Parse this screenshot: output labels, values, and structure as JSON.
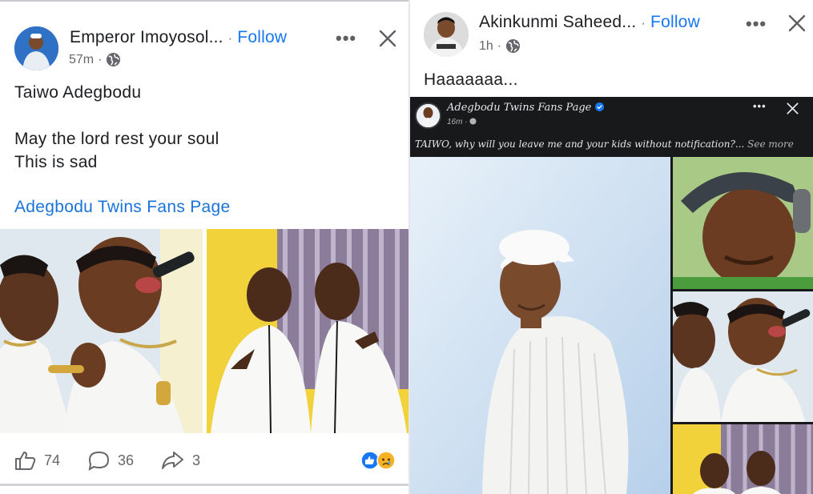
{
  "left_post": {
    "author": "Emperor Imoyosol...",
    "separator": "·",
    "follow": "Follow",
    "time": "57m",
    "more_label": "•••",
    "text_line1": "Taiwo Adegbodu",
    "text_line2": "May the lord rest your soul",
    "text_line3": "This is sad",
    "link": "Adegbodu Twins Fans Page",
    "likes": "74",
    "comments": "36",
    "shares": "3"
  },
  "right_post": {
    "author": "Akinkunmi Saheed...",
    "separator": "·",
    "follow": "Follow",
    "time": "1h",
    "more_label": "•••",
    "text": "Haaaaaaa...",
    "shared": {
      "page_name": "Adegbodu Twins Fans Page",
      "time": "16m",
      "more_label": "•••",
      "caption": "TAIWO, why will you leave me and your kids without notification?...",
      "see_more": "See more"
    }
  },
  "colors": {
    "follow_blue": "#1877f2",
    "link_blue": "#1a73d8",
    "meta_gray": "#65676b",
    "like_badge": "#1877f2",
    "sad_badge": "#f7b125"
  },
  "icons": [
    "globe-icon",
    "close-icon",
    "like-icon",
    "comment-icon",
    "share-icon",
    "verified-badge-icon",
    "sad-reaction-icon"
  ]
}
